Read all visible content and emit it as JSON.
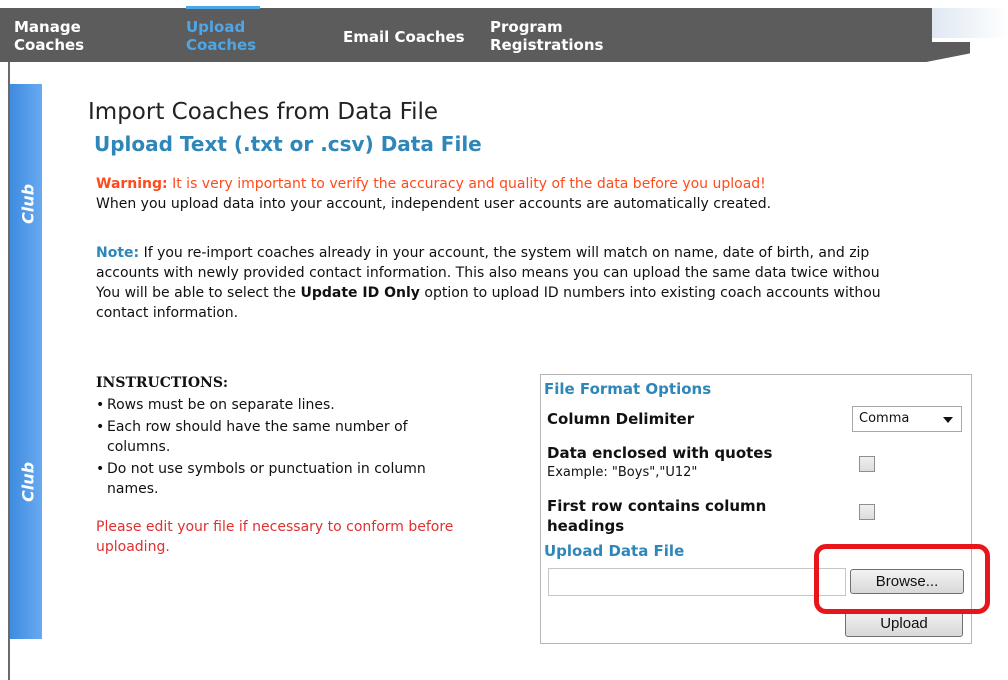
{
  "nav": {
    "items": [
      {
        "line1": "Manage",
        "line2": "Coaches"
      },
      {
        "line1": "Upload",
        "line2": "Coaches"
      },
      {
        "line1": "Email Coaches",
        "line2": ""
      },
      {
        "line1": "Program",
        "line2": "Registrations"
      }
    ],
    "active_index": 1,
    "active_color": "#4da6e8"
  },
  "sidebar": {
    "labels": [
      "Club",
      "Club"
    ],
    "color": "#4a95e6"
  },
  "page": {
    "title": "Import Coaches from Data File",
    "section_title": "Upload Text (.txt or .csv) Data File",
    "warning_label": "Warning:",
    "warning_text": " It is very important to verify the accuracy and quality of the data before you upload!",
    "warning_line2": "When you upload data into your account, independent user accounts are automatically created.",
    "note_label": "Note:",
    "note_line1": " If you re-import coaches already in your account, the system will match on name, date of birth, and zip",
    "note_line2": "accounts with newly provided contact information. This also means you can upload the same data twice withou",
    "note_line3_pre": "You will be able to select the ",
    "note_line3_bold": "Update ID Only",
    "note_line3_post": " option to upload ID numbers into existing coach accounts withou",
    "note_line4": "contact information."
  },
  "instructions": {
    "heading": "INSTRUCTIONS:",
    "items": [
      "Rows must be on separate lines.",
      "Each row should have the same number of columns.",
      "Do not use symbols or punctuation in column names."
    ],
    "warning": "Please edit your file if necessary to conform before uploading."
  },
  "file_format": {
    "title": "File Format Options",
    "column_delimiter_label": "Column Delimiter",
    "column_delimiter_value": "Comma",
    "quotes_label": "Data enclosed with quotes",
    "quotes_example": "Example: \"Boys\",\"U12\"",
    "quotes_checked": false,
    "headings_label_line1": "First row contains column",
    "headings_label_line2": "headings",
    "headings_checked": false,
    "upload_title": "Upload Data File",
    "file_value": "",
    "browse_label": "Browse...",
    "upload_label": "Upload"
  },
  "colors": {
    "accent": "#2f86b8",
    "warning": "#ff4a1c",
    "highlight": "#e8151b"
  }
}
